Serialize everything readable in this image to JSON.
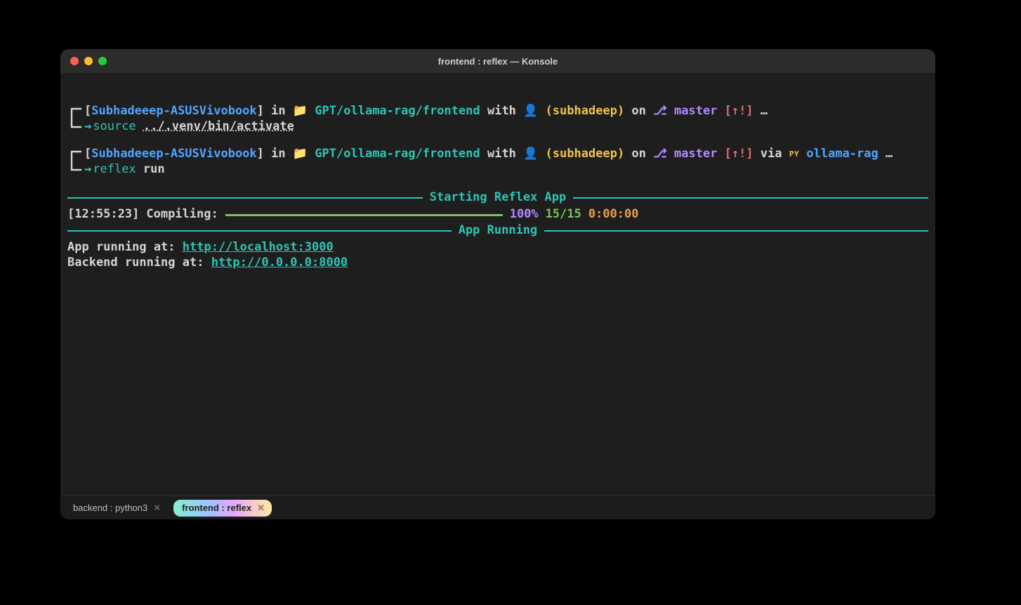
{
  "window": {
    "title": "frontend : reflex — Konsole"
  },
  "tabs": [
    {
      "label": "backend : python3",
      "active": false
    },
    {
      "label": "frontend : reflex",
      "active": true
    }
  ],
  "prompts": [
    {
      "host": "Subhadeeep-ASUSVivobook",
      "in_word": "in",
      "path": "GPT/ollama-rag/frontend",
      "with_word": "with",
      "user": "subhadeep",
      "on_word": "on",
      "branch": "master",
      "branch_state": "[↑!]",
      "via_lang": null,
      "via_env": null,
      "ellipsis": "…",
      "cmd": "source",
      "arg": "../.venv/bin/activate"
    },
    {
      "host": "Subhadeeep-ASUSVivobook",
      "in_word": "in",
      "path": "GPT/ollama-rag/frontend",
      "with_word": "with",
      "user": "subhadeep",
      "on_word": "on",
      "branch": "master",
      "branch_state": "[↑!]",
      "via_word": "via",
      "via_lang": "PY",
      "via_env": "ollama-rag",
      "ellipsis": "…",
      "cmd": "reflex",
      "arg": "run"
    }
  ],
  "headers": {
    "starting": "Starting Reflex App",
    "running": "App Running"
  },
  "compile": {
    "time": "[12:55:23]",
    "label": "Compiling:",
    "percent": "100%",
    "count": "15/15",
    "elapsed": "0:00:00"
  },
  "app": {
    "prefix": "App running at: ",
    "url": "http://localhost:3000"
  },
  "backend": {
    "prefix": "Backend running at: ",
    "url": "http://0.0.0.0:8000"
  },
  "icons": {
    "folder": "folder-icon",
    "user": "user-icon",
    "branch": "branch-icon"
  }
}
